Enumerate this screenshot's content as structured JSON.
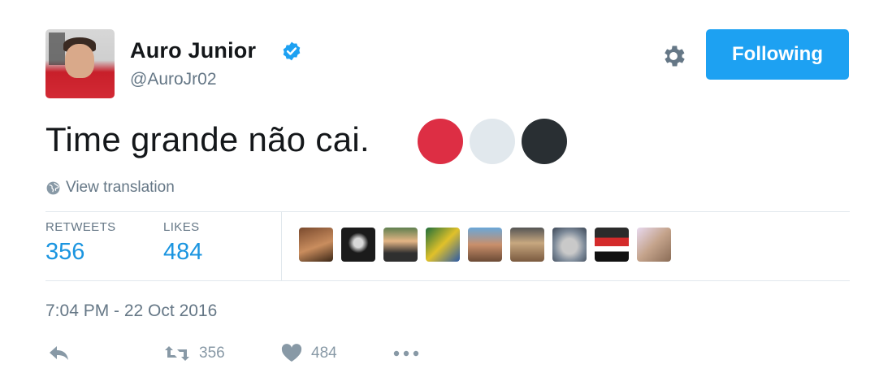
{
  "user": {
    "display_name": "Auro Junior",
    "handle": "@AuroJr02",
    "verified": true,
    "avatar_icon": "profile-photo"
  },
  "header": {
    "follow_label": "Following",
    "settings_icon": "gear-icon"
  },
  "tweet": {
    "text": "Time grande não cai.",
    "emoji_colors": [
      "#dd2e44",
      "#e1e8ed",
      "#292f33"
    ],
    "translate_label": "View translation"
  },
  "stats": {
    "retweets_label": "RETWEETS",
    "retweets_count": "356",
    "likes_label": "LIKES",
    "likes_count": "484"
  },
  "likers": {
    "count_shown": 9
  },
  "timestamp": "7:04 PM - 22 Oct 2016",
  "actions": {
    "retweet_count": "356",
    "like_count": "484"
  },
  "colors": {
    "accent": "#1da1f2",
    "link": "#1b95e0",
    "muted": "#657786",
    "text": "#14171a"
  }
}
